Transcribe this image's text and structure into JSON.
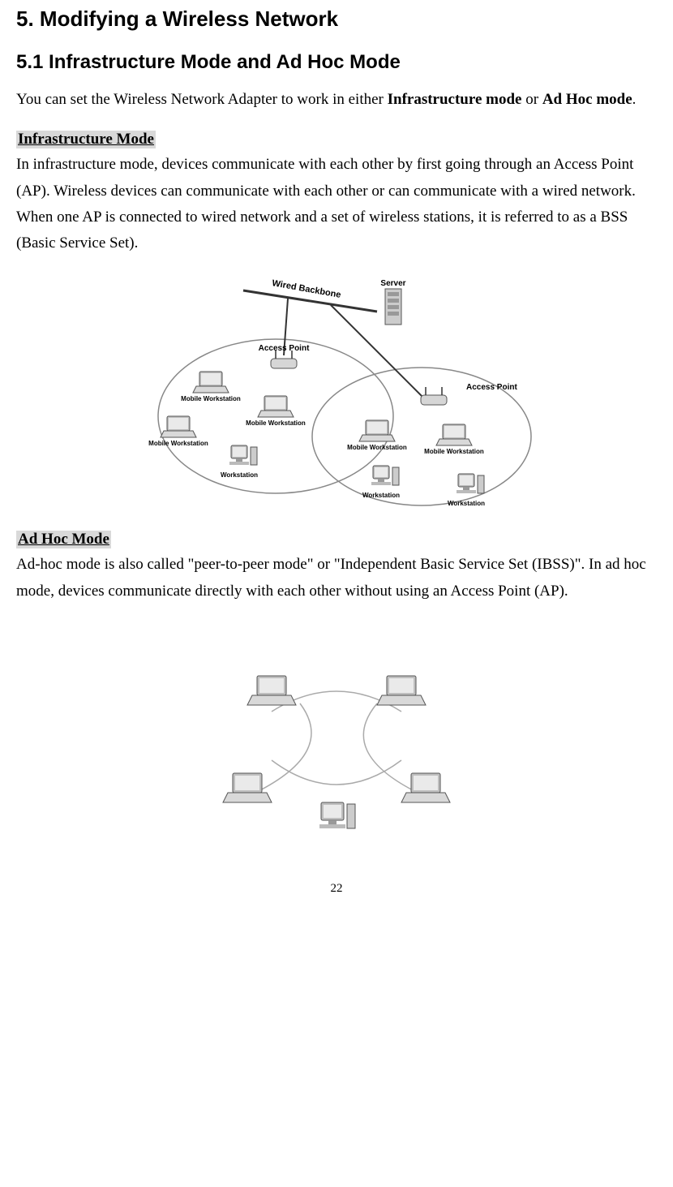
{
  "headings": {
    "section": "5. Modifying a Wireless Network",
    "subsection": "5.1 Infrastructure Mode and Ad Hoc Mode"
  },
  "intro": {
    "pre": "You can set the Wireless Network Adapter to work in either ",
    "mode1": "Infrastructure mode",
    "mid": " or ",
    "mode2": "Ad Hoc mode",
    "post": "."
  },
  "infra": {
    "label": "Infrastructure Mode",
    "text": "In infrastructure mode, devices communicate with each other by first going through an Access Point (AP).   Wireless devices can communicate with each other or can communicate with a wired network.  When one AP is connected to wired network and a set of wireless stations, it is referred to as a BSS (Basic Service Set)."
  },
  "diagram1": {
    "labels": {
      "wired_backbone": "Wired Backbone",
      "server": "Server",
      "access_point": "Access Point",
      "mobile_workstation": "Mobile Workstation",
      "workstation": "Workstation"
    }
  },
  "adhoc": {
    "label": "Ad Hoc Mode",
    "text": "Ad-hoc mode is also called \"peer-to-peer mode\" or \"Independent Basic Service Set (IBSS)\".  In ad hoc mode, devices communicate directly with each other without using an Access Point (AP)."
  },
  "page_number": "22"
}
